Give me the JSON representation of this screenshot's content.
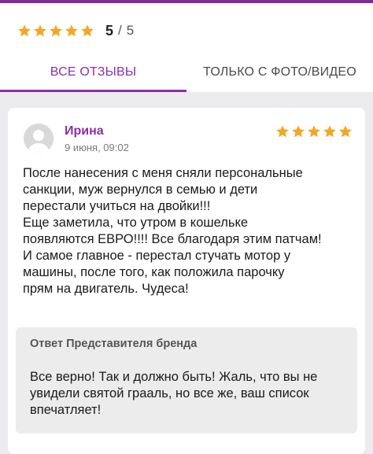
{
  "colors": {
    "accent": "#8a2fa8",
    "star": "#f5a623",
    "top_bar": "#7b2f9b",
    "background": "#ecebee"
  },
  "rating_summary": {
    "stars": 5,
    "value": "5",
    "separator": "/",
    "max": "5"
  },
  "tabs": [
    {
      "label": "Все отзывы",
      "active": true
    },
    {
      "label": "Только с фото/видео",
      "active": false
    }
  ],
  "review": {
    "avatar_icon": "user-avatar-icon",
    "author": "Ирина",
    "date": "9 июня, 09:02",
    "stars": 5,
    "text": "После нанесения с меня сняли персональные\nсанкции, муж вернулся в семью и дети\nперестали учиться на двойки!!!\nЕще заметила, что утром в кошельке\nпоявляются ЕВРО!!!! Все благодаря этим патчам!\nИ самое главное - перестал стучать мотор у\nмашины, после того, как положила парочку\nпрям на двигатель. Чудеса!",
    "brand_reply": {
      "title": "Ответ Представителя бренда",
      "text": "Все верно! Так и должно быть! Жаль, что вы не\nувидели святой грааль, но все же, ваш список\nвпечатляет!"
    }
  }
}
